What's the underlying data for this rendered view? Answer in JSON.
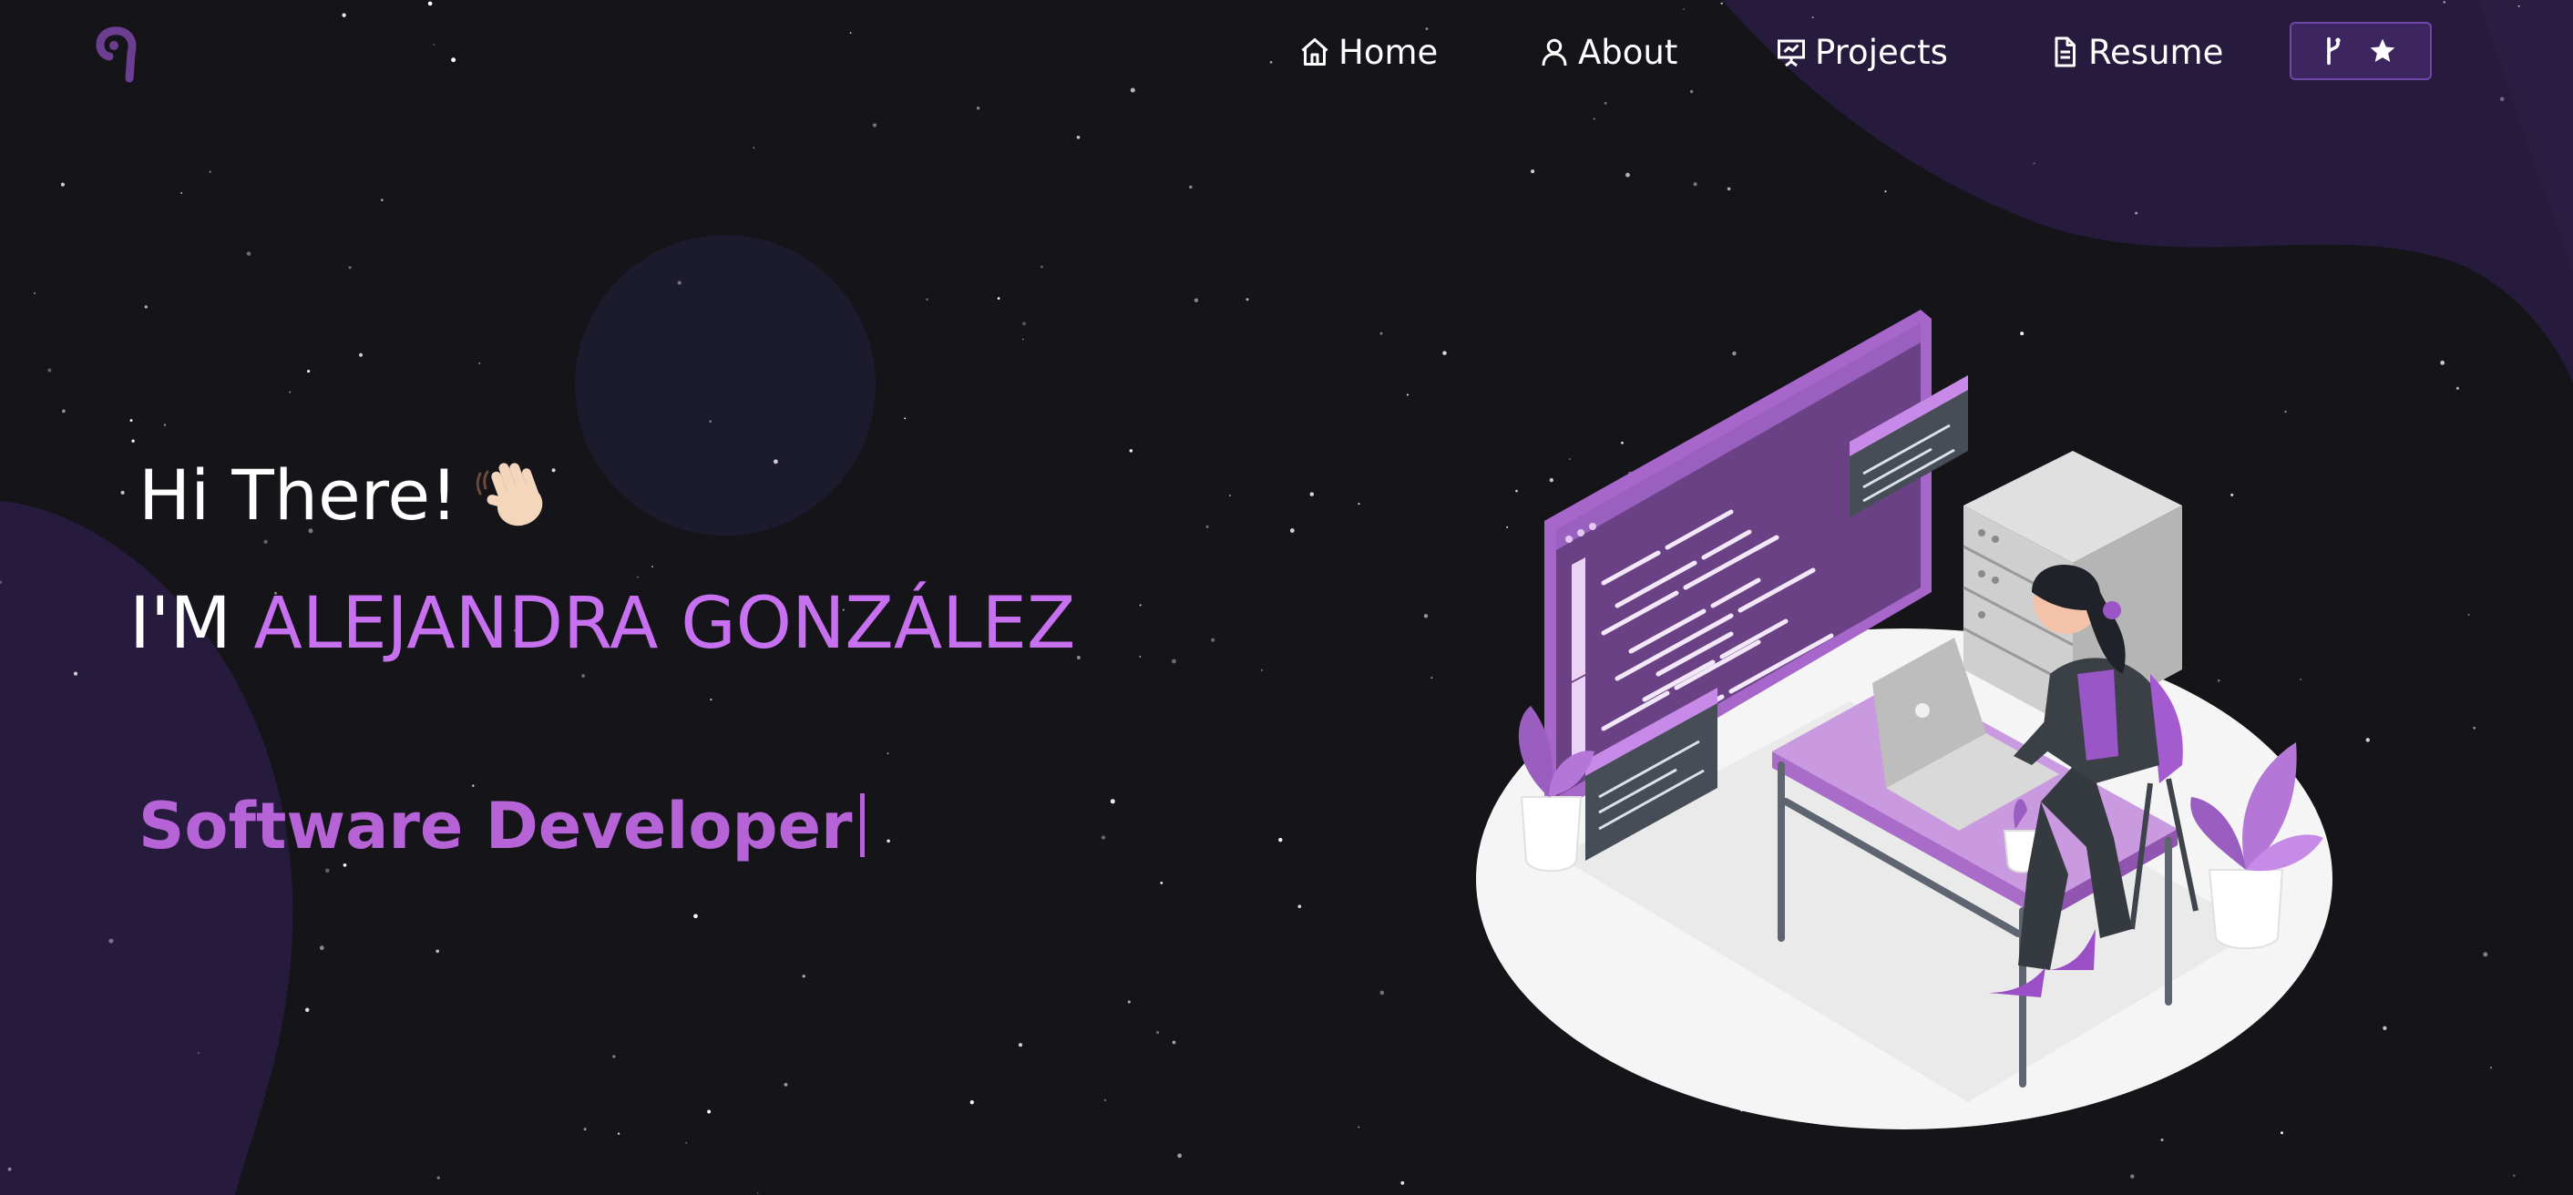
{
  "nav": {
    "items": [
      {
        "label": "Home",
        "icon": "home-icon"
      },
      {
        "label": "About",
        "icon": "user-icon"
      },
      {
        "label": "Projects",
        "icon": "presentation-icon"
      },
      {
        "label": "Resume",
        "icon": "document-icon"
      }
    ],
    "fork_button": {
      "icons": [
        "git-fork-icon",
        "star-icon"
      ]
    }
  },
  "hero": {
    "greeting": "Hi There!",
    "greeting_emoji": "👋🏻",
    "name_prefix": "I'M",
    "name": "ALEJANDRA GONZÁLEZ",
    "typed_text": "Software Developer"
  },
  "colors": {
    "background": "#141419",
    "accent": "#c770f0",
    "accent_dark": "#b563d6",
    "button_bg": "#3d2560",
    "blob": "#261a3d"
  }
}
